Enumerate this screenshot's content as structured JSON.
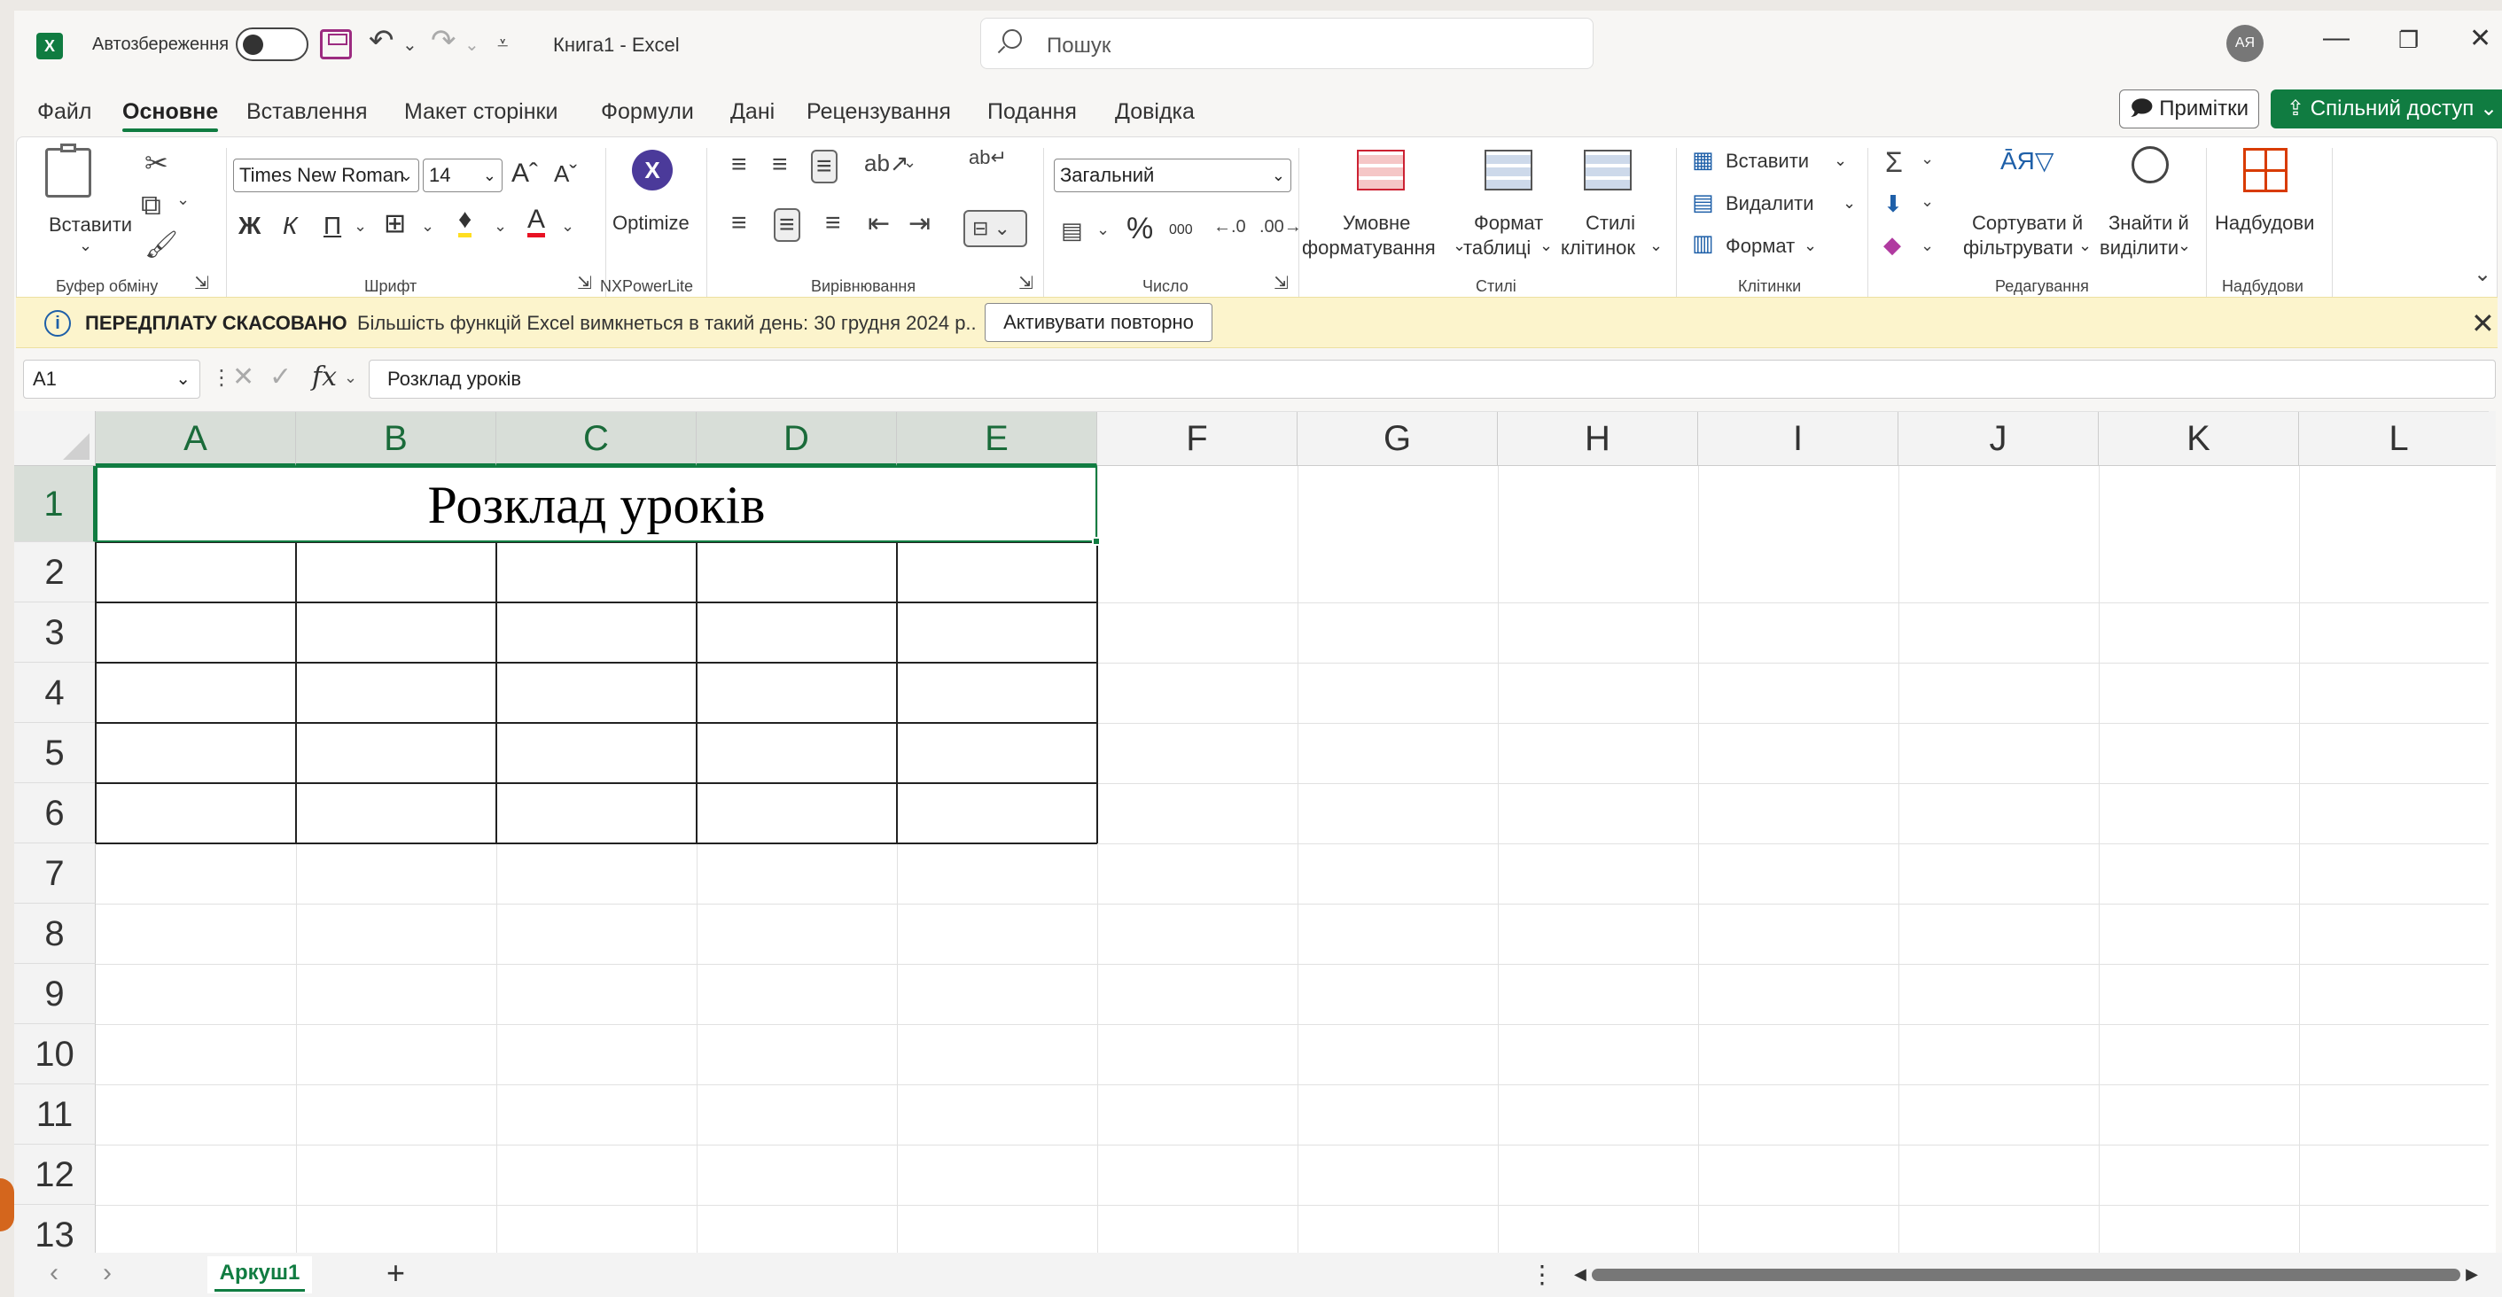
{
  "titlebar": {
    "autosave_label": "Автозбереження",
    "doc_title": "Книга1  -  Excel",
    "search_placeholder": "Пошук",
    "avatar_initials": "АЯ"
  },
  "menu": {
    "tabs": [
      "Файл",
      "Основне",
      "Вставлення",
      "Макет сторінки",
      "Формули",
      "Дані",
      "Рецензування",
      "Подання",
      "Довідка"
    ],
    "active_tab": "Основне",
    "notes_label": "Примітки",
    "share_label": "Спільний доступ"
  },
  "ribbon": {
    "clipboard": {
      "paste": "Вставити",
      "group": "Буфер обміну"
    },
    "font": {
      "name": "Times New Roman",
      "size": "14",
      "bold": "Ж",
      "italic": "К",
      "underline": "П",
      "group": "Шрифт"
    },
    "nxpowerlite": {
      "optimize": "Optimize",
      "group": "NXPowerLite"
    },
    "alignment": {
      "group": "Вирівнювання"
    },
    "number": {
      "format": "Загальний",
      "percent": "%",
      "thousands": "000",
      "group": "Число"
    },
    "styles": {
      "conditional_1": "Умовне",
      "conditional_2": "форматування",
      "table_1": "Формат",
      "table_2": "таблиці",
      "cell_1": "Стилі",
      "cell_2": "клітинок",
      "group": "Стилі"
    },
    "cells": {
      "insert": "Вставити",
      "delete": "Видалити",
      "format": "Формат",
      "group": "Клітинки"
    },
    "editing": {
      "sort_1": "Сортувати й",
      "sort_2": "фільтрувати",
      "find_1": "Знайти й",
      "find_2": "виділити",
      "group": "Редагування"
    },
    "addins": {
      "label": "Надбудови",
      "group": "Надбудови"
    }
  },
  "notification": {
    "title": "ПЕРЕДПЛАТУ СКАСОВАНО",
    "message": "Більшість функцій Excel вимкнеться в такий день: 30 грудня 2024 р..",
    "button": "Активувати повторно"
  },
  "formula_bar": {
    "name_box": "A1",
    "fx": "fx",
    "content": "Розклад уроків"
  },
  "grid": {
    "columns": [
      "A",
      "B",
      "C",
      "D",
      "E",
      "F",
      "G",
      "H",
      "I",
      "J",
      "K",
      "L"
    ],
    "rows": [
      "1",
      "2",
      "3",
      "4",
      "5",
      "6",
      "7",
      "8",
      "9",
      "10",
      "11",
      "12",
      "13"
    ],
    "merged_a1_e1": "Розклад уроків"
  },
  "sheets": {
    "tabs": [
      "Аркуш1"
    ],
    "add": "+"
  },
  "colors": {
    "accent": "#107c41",
    "notification_bg": "#fcf4cc"
  }
}
